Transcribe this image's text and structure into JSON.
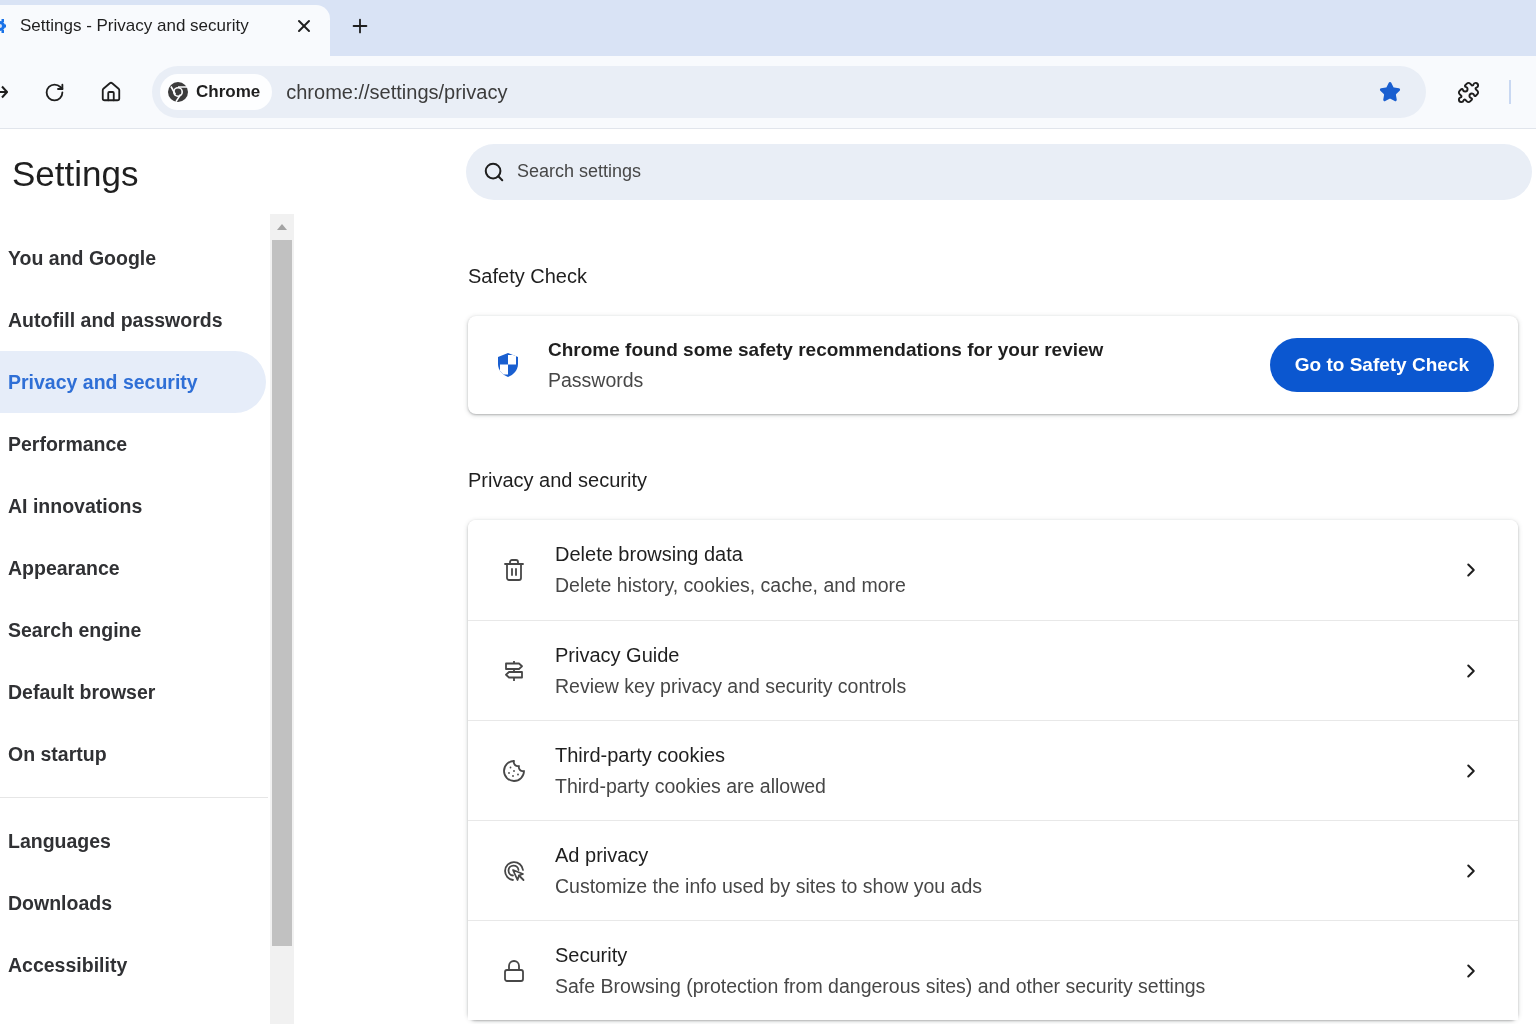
{
  "tab_strip": {
    "tabs": [
      {
        "title": "Settings - Privacy and security",
        "selected": true
      }
    ]
  },
  "toolbar": {
    "site_chip": "Chrome",
    "url": "chrome://settings/privacy",
    "bookmarked": true
  },
  "sidebar": {
    "title": "Settings",
    "groups": [
      {
        "items": [
          {
            "label": "You and Google",
            "selected": false
          },
          {
            "label": "Autofill and passwords",
            "selected": false
          },
          {
            "label": "Privacy and security",
            "selected": true
          },
          {
            "label": "Performance",
            "selected": false
          },
          {
            "label": "AI innovations",
            "selected": false
          },
          {
            "label": "Appearance",
            "selected": false
          },
          {
            "label": "Search engine",
            "selected": false
          },
          {
            "label": "Default browser",
            "selected": false
          },
          {
            "label": "On startup",
            "selected": false
          }
        ]
      },
      {
        "items": [
          {
            "label": "Languages",
            "selected": false
          },
          {
            "label": "Downloads",
            "selected": false
          },
          {
            "label": "Accessibility",
            "selected": false
          }
        ]
      }
    ]
  },
  "search": {
    "placeholder": "Search settings"
  },
  "safety_check": {
    "heading": "Safety Check",
    "message": "Chrome found some safety recommendations for your review",
    "detail": "Passwords",
    "button": "Go to Safety Check"
  },
  "privacy_and_security": {
    "heading": "Privacy and security",
    "rows": [
      {
        "title": "Delete browsing data",
        "subtitle": "Delete history, cookies, cache, and more"
      },
      {
        "title": "Privacy Guide",
        "subtitle": "Review key privacy and security controls"
      },
      {
        "title": "Third-party cookies",
        "subtitle": "Third-party cookies are allowed"
      },
      {
        "title": "Ad privacy",
        "subtitle": "Customize the info used by sites to show you ads"
      },
      {
        "title": "Security",
        "subtitle": "Safe Browsing (protection from dangerous sites) and other security settings"
      }
    ]
  }
}
